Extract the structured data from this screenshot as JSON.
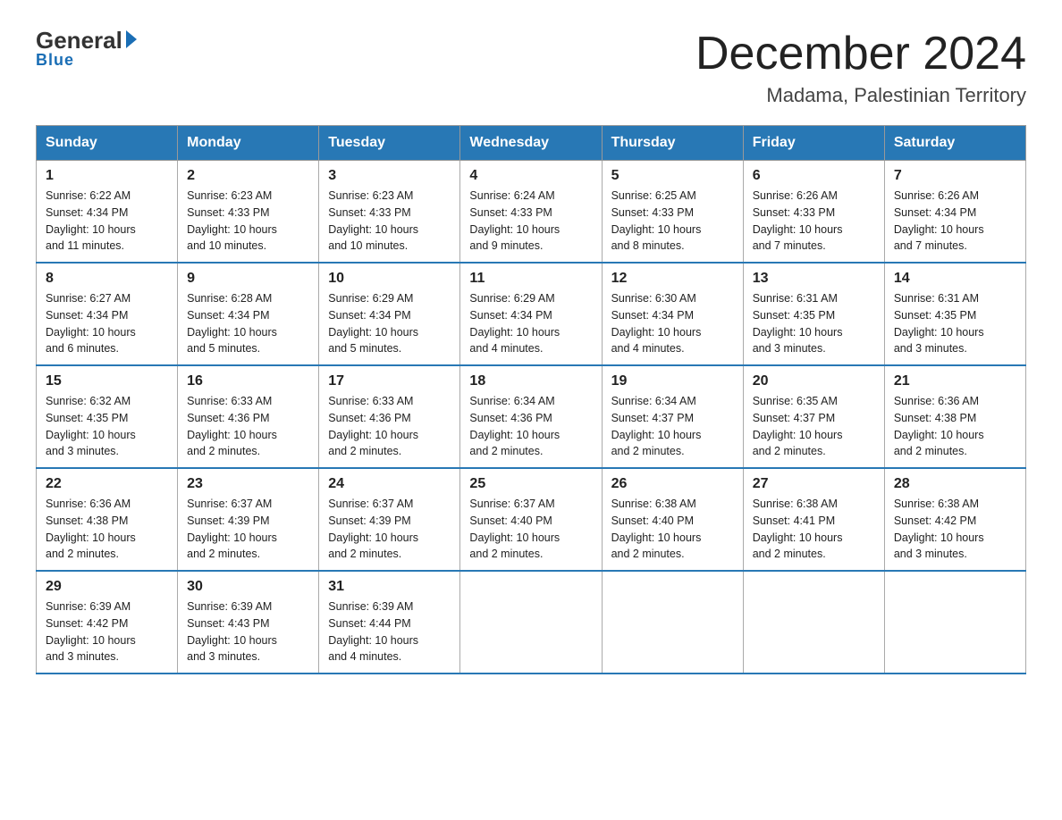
{
  "header": {
    "logo_general": "General",
    "logo_blue": "Blue",
    "month_title": "December 2024",
    "location": "Madama, Palestinian Territory"
  },
  "weekdays": [
    "Sunday",
    "Monday",
    "Tuesday",
    "Wednesday",
    "Thursday",
    "Friday",
    "Saturday"
  ],
  "weeks": [
    [
      {
        "day": "1",
        "sunrise": "6:22 AM",
        "sunset": "4:34 PM",
        "daylight": "10 hours and 11 minutes."
      },
      {
        "day": "2",
        "sunrise": "6:23 AM",
        "sunset": "4:33 PM",
        "daylight": "10 hours and 10 minutes."
      },
      {
        "day": "3",
        "sunrise": "6:23 AM",
        "sunset": "4:33 PM",
        "daylight": "10 hours and 10 minutes."
      },
      {
        "day": "4",
        "sunrise": "6:24 AM",
        "sunset": "4:33 PM",
        "daylight": "10 hours and 9 minutes."
      },
      {
        "day": "5",
        "sunrise": "6:25 AM",
        "sunset": "4:33 PM",
        "daylight": "10 hours and 8 minutes."
      },
      {
        "day": "6",
        "sunrise": "6:26 AM",
        "sunset": "4:33 PM",
        "daylight": "10 hours and 7 minutes."
      },
      {
        "day": "7",
        "sunrise": "6:26 AM",
        "sunset": "4:34 PM",
        "daylight": "10 hours and 7 minutes."
      }
    ],
    [
      {
        "day": "8",
        "sunrise": "6:27 AM",
        "sunset": "4:34 PM",
        "daylight": "10 hours and 6 minutes."
      },
      {
        "day": "9",
        "sunrise": "6:28 AM",
        "sunset": "4:34 PM",
        "daylight": "10 hours and 5 minutes."
      },
      {
        "day": "10",
        "sunrise": "6:29 AM",
        "sunset": "4:34 PM",
        "daylight": "10 hours and 5 minutes."
      },
      {
        "day": "11",
        "sunrise": "6:29 AM",
        "sunset": "4:34 PM",
        "daylight": "10 hours and 4 minutes."
      },
      {
        "day": "12",
        "sunrise": "6:30 AM",
        "sunset": "4:34 PM",
        "daylight": "10 hours and 4 minutes."
      },
      {
        "day": "13",
        "sunrise": "6:31 AM",
        "sunset": "4:35 PM",
        "daylight": "10 hours and 3 minutes."
      },
      {
        "day": "14",
        "sunrise": "6:31 AM",
        "sunset": "4:35 PM",
        "daylight": "10 hours and 3 minutes."
      }
    ],
    [
      {
        "day": "15",
        "sunrise": "6:32 AM",
        "sunset": "4:35 PM",
        "daylight": "10 hours and 3 minutes."
      },
      {
        "day": "16",
        "sunrise": "6:33 AM",
        "sunset": "4:36 PM",
        "daylight": "10 hours and 2 minutes."
      },
      {
        "day": "17",
        "sunrise": "6:33 AM",
        "sunset": "4:36 PM",
        "daylight": "10 hours and 2 minutes."
      },
      {
        "day": "18",
        "sunrise": "6:34 AM",
        "sunset": "4:36 PM",
        "daylight": "10 hours and 2 minutes."
      },
      {
        "day": "19",
        "sunrise": "6:34 AM",
        "sunset": "4:37 PM",
        "daylight": "10 hours and 2 minutes."
      },
      {
        "day": "20",
        "sunrise": "6:35 AM",
        "sunset": "4:37 PM",
        "daylight": "10 hours and 2 minutes."
      },
      {
        "day": "21",
        "sunrise": "6:36 AM",
        "sunset": "4:38 PM",
        "daylight": "10 hours and 2 minutes."
      }
    ],
    [
      {
        "day": "22",
        "sunrise": "6:36 AM",
        "sunset": "4:38 PM",
        "daylight": "10 hours and 2 minutes."
      },
      {
        "day": "23",
        "sunrise": "6:37 AM",
        "sunset": "4:39 PM",
        "daylight": "10 hours and 2 minutes."
      },
      {
        "day": "24",
        "sunrise": "6:37 AM",
        "sunset": "4:39 PM",
        "daylight": "10 hours and 2 minutes."
      },
      {
        "day": "25",
        "sunrise": "6:37 AM",
        "sunset": "4:40 PM",
        "daylight": "10 hours and 2 minutes."
      },
      {
        "day": "26",
        "sunrise": "6:38 AM",
        "sunset": "4:40 PM",
        "daylight": "10 hours and 2 minutes."
      },
      {
        "day": "27",
        "sunrise": "6:38 AM",
        "sunset": "4:41 PM",
        "daylight": "10 hours and 2 minutes."
      },
      {
        "day": "28",
        "sunrise": "6:38 AM",
        "sunset": "4:42 PM",
        "daylight": "10 hours and 3 minutes."
      }
    ],
    [
      {
        "day": "29",
        "sunrise": "6:39 AM",
        "sunset": "4:42 PM",
        "daylight": "10 hours and 3 minutes."
      },
      {
        "day": "30",
        "sunrise": "6:39 AM",
        "sunset": "4:43 PM",
        "daylight": "10 hours and 3 minutes."
      },
      {
        "day": "31",
        "sunrise": "6:39 AM",
        "sunset": "4:44 PM",
        "daylight": "10 hours and 4 minutes."
      },
      null,
      null,
      null,
      null
    ]
  ],
  "labels": {
    "sunrise": "Sunrise:",
    "sunset": "Sunset:",
    "daylight": "Daylight:"
  },
  "colors": {
    "header_bg": "#2878b5",
    "header_text": "#ffffff",
    "border": "#aaaaaa"
  }
}
